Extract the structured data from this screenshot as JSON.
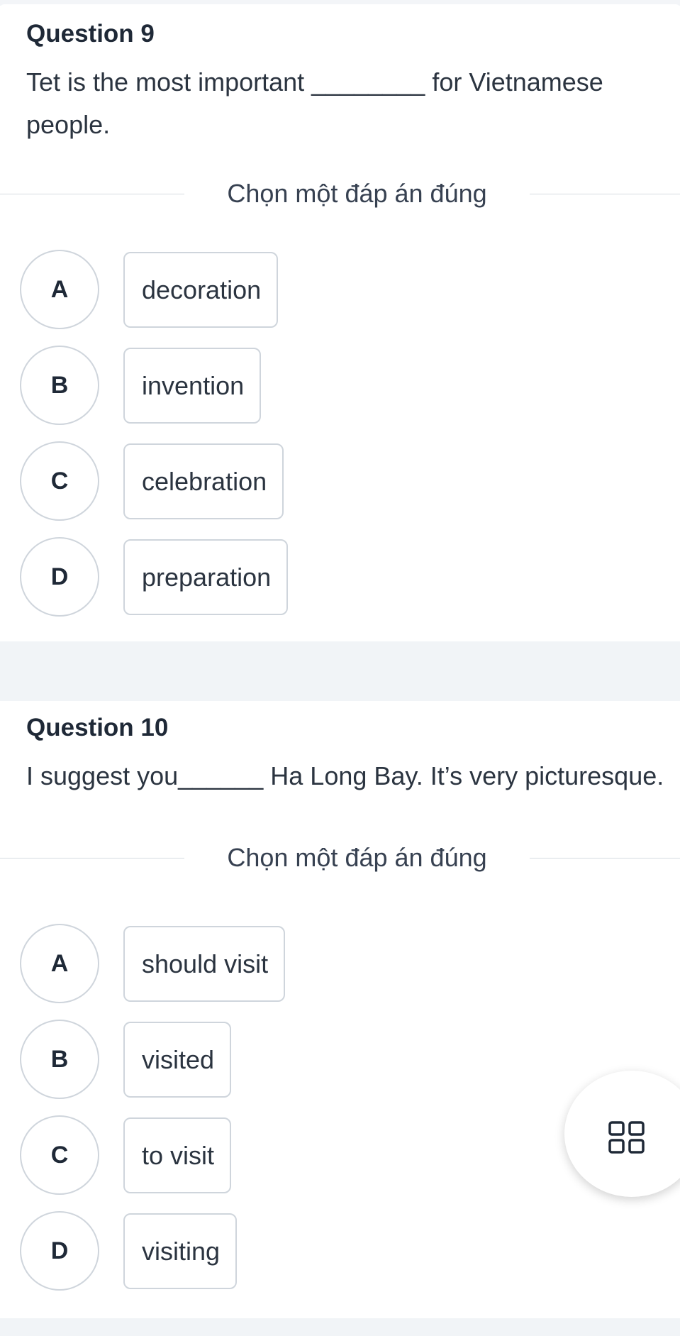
{
  "question9": {
    "title": "Question 9",
    "text_line1_a": "Tet is the most important ",
    "text_line1_blank": "________",
    "text_line1_b": " for Vietnamese",
    "text_line2": "people.",
    "instruction": "Chọn một đáp án đúng",
    "options": [
      {
        "letter": "A",
        "text": "decoration"
      },
      {
        "letter": "B",
        "text": "invention"
      },
      {
        "letter": "C",
        "text": "celebration"
      },
      {
        "letter": "D",
        "text": "preparation"
      }
    ]
  },
  "question10": {
    "title": "Question 10",
    "text_a": "I suggest you",
    "text_blank": "______",
    "text_b": " Ha Long Bay. It’s very picturesque.",
    "instruction": "Chọn một đáp án đúng",
    "options": [
      {
        "letter": "A",
        "text": "should visit"
      },
      {
        "letter": "B",
        "text": "visited"
      },
      {
        "letter": "C",
        "text": "to visit"
      },
      {
        "letter": "D",
        "text": "visiting"
      }
    ]
  },
  "floating_button": {
    "icon": "grid-icon"
  }
}
